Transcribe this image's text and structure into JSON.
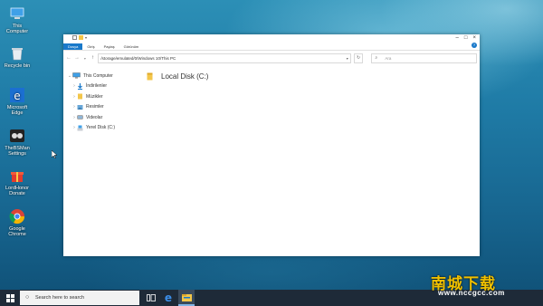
{
  "desktop": {
    "icons": [
      {
        "label": "This Computer",
        "icon": "computer-icon"
      },
      {
        "label": "Recycle bin",
        "icon": "recycle-bin-icon"
      },
      {
        "label": "Microsoft Edge",
        "icon": "edge-icon"
      },
      {
        "label": "TheBSMan Settings",
        "icon": "settings-icon"
      },
      {
        "label": "LordHonor Donate",
        "icon": "gift-icon"
      },
      {
        "label": "Google Chrome",
        "icon": "chrome-icon"
      }
    ]
  },
  "explorer": {
    "title_chevron": "▾",
    "ribbon_tabs": [
      "Dosya",
      "Giriş",
      "Paylaş",
      "Görünüm"
    ],
    "help_label": "?",
    "address": "/storage/emulated/0/Windows 10/This PC",
    "search_placeholder": "Ara",
    "nav_items": [
      {
        "label": "This Computer",
        "icon": "computer-icon"
      },
      {
        "label": "İndirilenler",
        "icon": "downloads-icon"
      },
      {
        "label": "Müzikler",
        "icon": "music-folder-icon"
      },
      {
        "label": "Resimler",
        "icon": "pictures-icon"
      },
      {
        "label": "Videolar",
        "icon": "videos-icon"
      },
      {
        "label": "Yerel Disk (C:)",
        "icon": "drive-icon"
      }
    ],
    "drive_label": "Local Disk (C:)"
  },
  "taskbar": {
    "search_placeholder": "Search here to search"
  },
  "watermark": {
    "text": "南城下载",
    "url": "www.nccgcc.com"
  },
  "colors": {
    "accent": "#1979ca",
    "taskbar": "#1e2a38"
  }
}
